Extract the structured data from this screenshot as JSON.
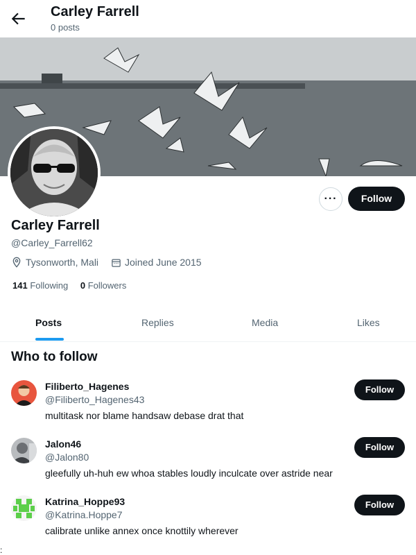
{
  "header": {
    "title": "Carley Farrell",
    "subtitle": "0 posts"
  },
  "profile": {
    "name": "Carley Farrell",
    "handle": "@Carley_Farrell62",
    "location": "Tysonworth, Mali",
    "joined": "Joined June 2015",
    "following_count": "141",
    "following_label": "Following",
    "followers_count": "0",
    "followers_label": "Followers",
    "more_label": "···",
    "follow_label": "Follow"
  },
  "tabs": [
    {
      "label": "Posts",
      "active": true
    },
    {
      "label": "Replies",
      "active": false
    },
    {
      "label": "Media",
      "active": false
    },
    {
      "label": "Likes",
      "active": false
    }
  ],
  "who_to_follow": {
    "title": "Who to follow",
    "users": [
      {
        "name": "Filiberto_Hagenes",
        "handle": "@Filiberto_Hagenes43",
        "bio": "multitask nor blame handsaw debase drat that",
        "button": "Follow"
      },
      {
        "name": "Jalon46",
        "handle": "@Jalon80",
        "bio": "gleefully uh-huh ew whoa stables loudly inculcate over astride near",
        "button": "Follow"
      },
      {
        "name": "Katrina_Hoppe93",
        "handle": "@Katrina.Hoppe7",
        "bio": "calibrate unlike annex once knottily wherever",
        "button": "Follow"
      }
    ]
  },
  "footer_mark": ":",
  "colors": {
    "accent": "#1d9bf0",
    "button": "#0f1419",
    "muted": "#536471"
  }
}
